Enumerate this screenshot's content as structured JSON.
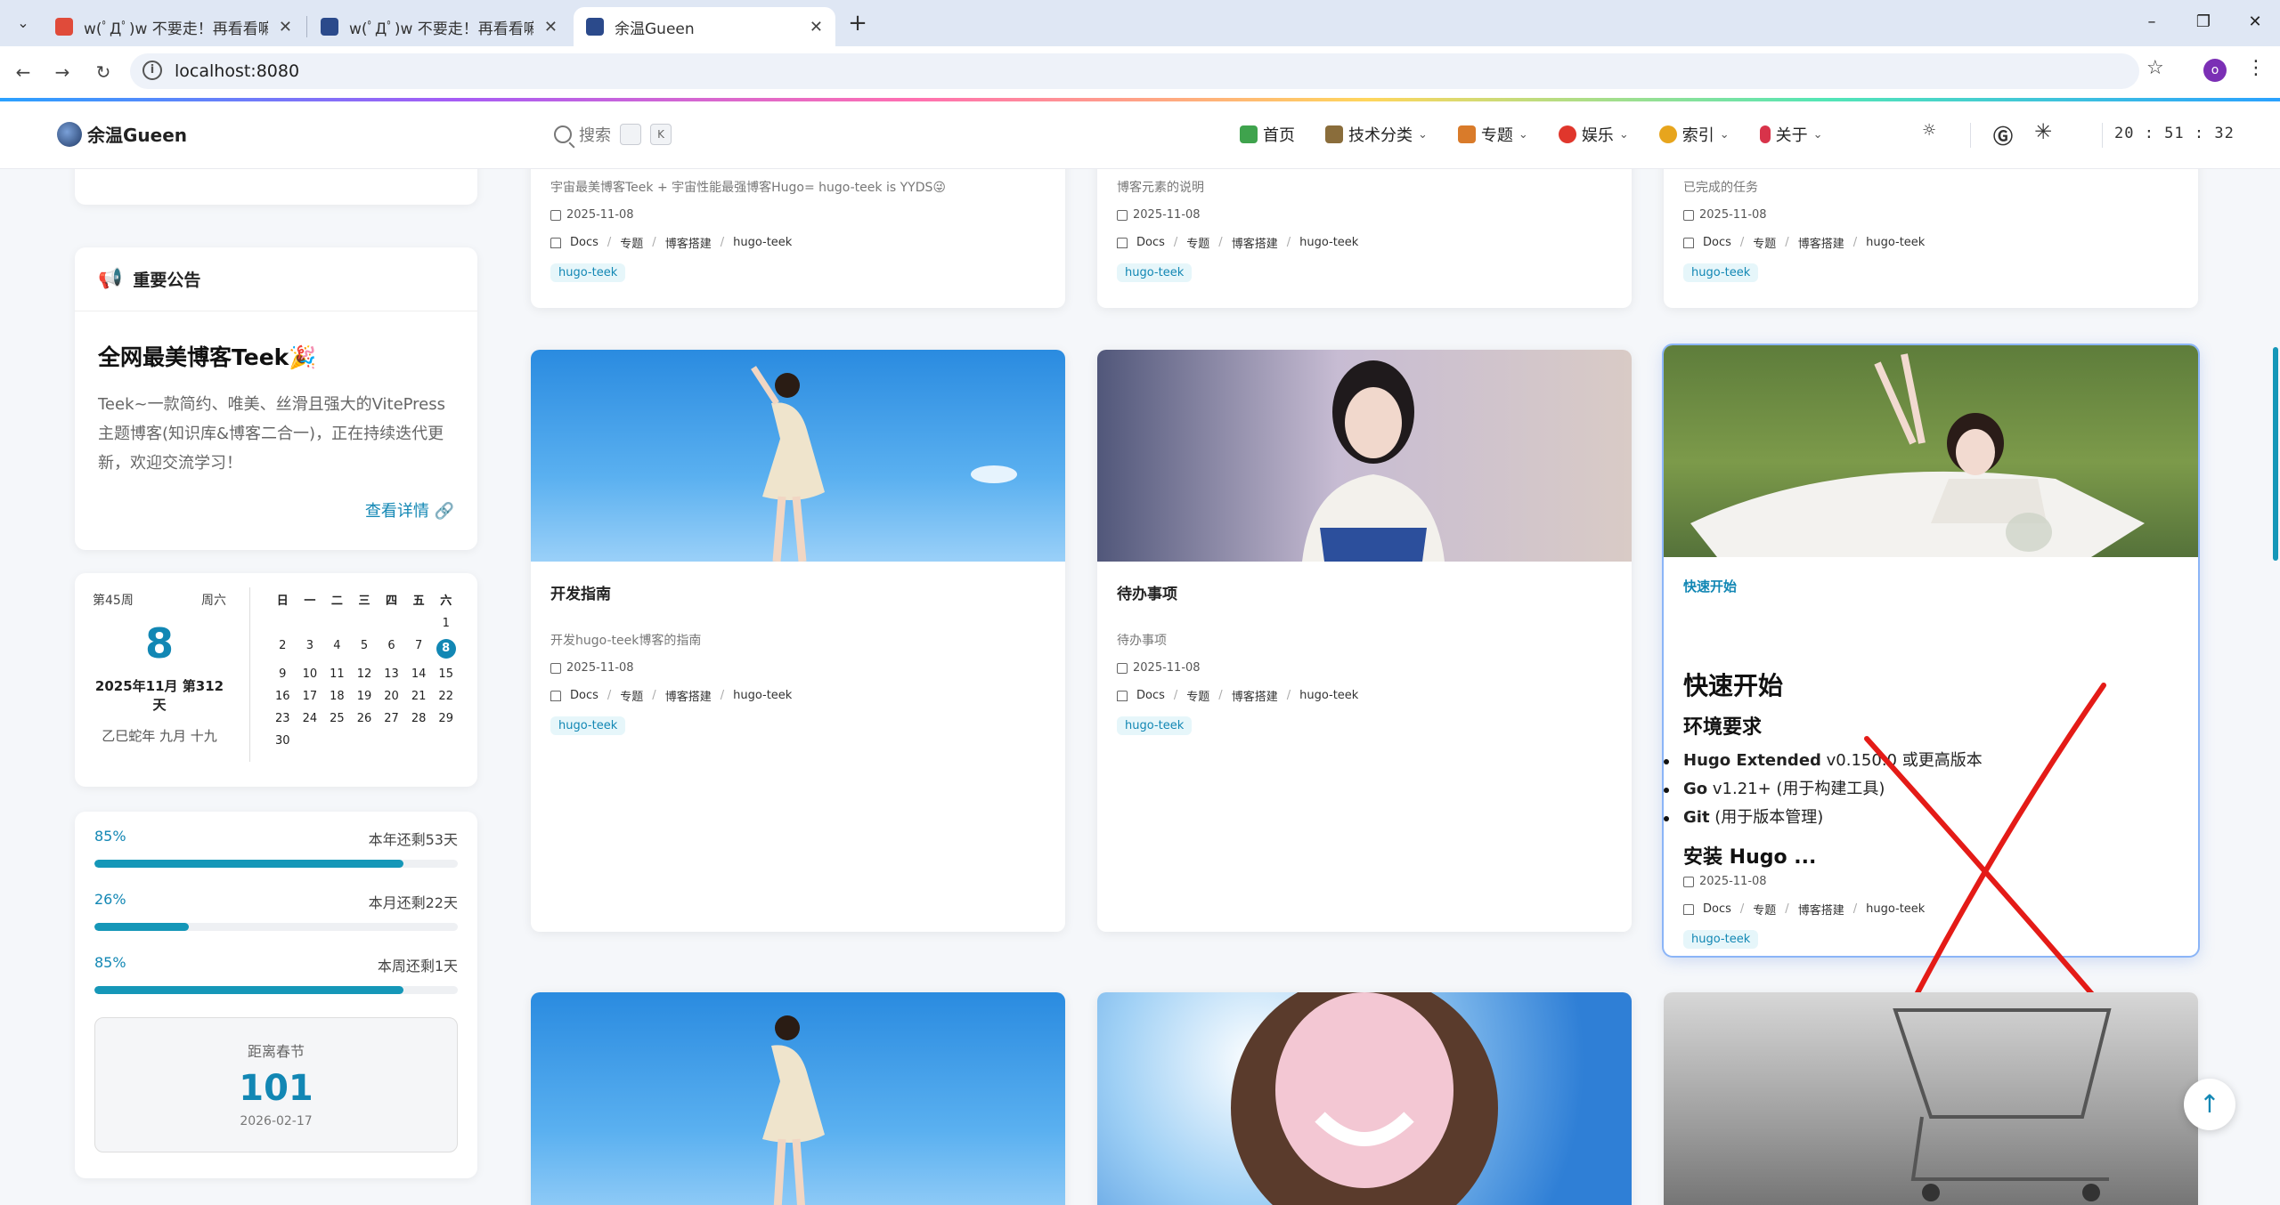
{
  "browser": {
    "tabs": [
      {
        "title": "w(ﾟДﾟ)w 不要走！再看看嘛！",
        "favicon_color": "#e04b3a"
      },
      {
        "title": "w(ﾟДﾟ)w 不要走！再看看嘛！",
        "favicon_color": "#2b4a8b"
      },
      {
        "title": "余温Gueen",
        "favicon_color": "#2b4a8b"
      }
    ],
    "url": "localhost:8080",
    "profile_initial": "o"
  },
  "header": {
    "site_name": "余温Gueen",
    "search_placeholder": "搜索",
    "search_keys": [
      "",
      "K"
    ],
    "nav": [
      {
        "label": "首页",
        "icon": "home-icon",
        "color": "#3fa34d",
        "caret": false
      },
      {
        "label": "技术分类",
        "icon": "book-icon",
        "color": "#8a6d3b",
        "caret": true
      },
      {
        "label": "专题",
        "icon": "palette-icon",
        "color": "#d97b2a",
        "caret": true
      },
      {
        "label": "娱乐",
        "icon": "chat-icon",
        "color": "#e0362c",
        "caret": true
      },
      {
        "label": "索引",
        "icon": "hand-icon",
        "color": "#e7a51d",
        "caret": true
      },
      {
        "label": "关于",
        "icon": "pin-icon",
        "color": "#d8334a",
        "caret": true
      }
    ],
    "clock": "20 : 51 : 32"
  },
  "announcement": {
    "heading": "重要公告",
    "title": "全网最美博客Teek🎉",
    "body": "Teek~一款简约、唯美、丝滑且强大的VitePress主题博客(知识库&博客二合一)，正在持续迭代更新，欢迎交流学习！",
    "link_label": "查看详情 🔗"
  },
  "calendar": {
    "week_no": "第45周",
    "weekday": "周六",
    "day": "8",
    "date_line": "2025年11月  第312天",
    "lunar": "乙巳蛇年  九月  十九",
    "weekday_headers": [
      "日",
      "一",
      "二",
      "三",
      "四",
      "五",
      "六"
    ],
    "cells": [
      "",
      "",
      "",
      "",
      "",
      "",
      "1",
      "2",
      "3",
      "4",
      "5",
      "6",
      "7",
      "8",
      "9",
      "10",
      "11",
      "12",
      "13",
      "14",
      "15",
      "16",
      "17",
      "18",
      "19",
      "20",
      "21",
      "22",
      "23",
      "24",
      "25",
      "26",
      "27",
      "28",
      "29",
      "30"
    ],
    "today": "8"
  },
  "progress": [
    {
      "pct": "85%",
      "label": "本年还剩53天",
      "value": 0.85
    },
    {
      "pct": "26%",
      "label": "本月还剩22天",
      "value": 0.26
    },
    {
      "pct": "85%",
      "label": "本周还剩1天",
      "value": 0.85
    }
  ],
  "countdown": {
    "label": "距离春节",
    "days": "101",
    "date": "2026-02-17"
  },
  "posts_top": [
    {
      "desc": "宇宙最美博客Teek + 宇宙性能最强博客Hugo= hugo-teek is YYDS😜",
      "date": "2025-11-08",
      "crumbs": [
        "Docs",
        "专题",
        "博客搭建",
        "hugo-teek"
      ],
      "tag": "hugo-teek"
    },
    {
      "desc": "博客元素的说明",
      "date": "2025-11-08",
      "crumbs": [
        "Docs",
        "专题",
        "博客搭建",
        "hugo-teek"
      ],
      "tag": "hugo-teek"
    },
    {
      "desc": "已完成的任务",
      "date": "2025-11-08",
      "crumbs": [
        "Docs",
        "专题",
        "博客搭建",
        "hugo-teek"
      ],
      "tag": "hugo-teek"
    }
  ],
  "posts_mid": [
    {
      "title": "开发指南",
      "desc": "开发hugo-teek博客的指南",
      "date": "2025-11-08",
      "crumbs": [
        "Docs",
        "专题",
        "博客搭建",
        "hugo-teek"
      ],
      "tag": "hugo-teek"
    },
    {
      "title": "待办事项",
      "desc": "待办事项",
      "date": "2025-11-08",
      "crumbs": [
        "Docs",
        "专题",
        "博客搭建",
        "hugo-teek"
      ],
      "tag": "hugo-teek"
    },
    {
      "category": "快速开始",
      "h1": "快速开始",
      "h2a": "环境要求",
      "li1_b": "Hugo Extended",
      "li1": " v0.150.0 或更高版本",
      "li2_b": "Go",
      "li2": " v1.21+ (用于构建工具)",
      "li3_b": "Git",
      "li3": " (用于版本管理)",
      "h2b": "安装 Hugo ...",
      "date": "2025-11-08",
      "crumbs": [
        "Docs",
        "专题",
        "博客搭建",
        "hugo-teek"
      ],
      "tag": "hugo-teek"
    }
  ],
  "colors": {
    "accent": "#1287b4",
    "annotation_red": "#e41b17"
  }
}
